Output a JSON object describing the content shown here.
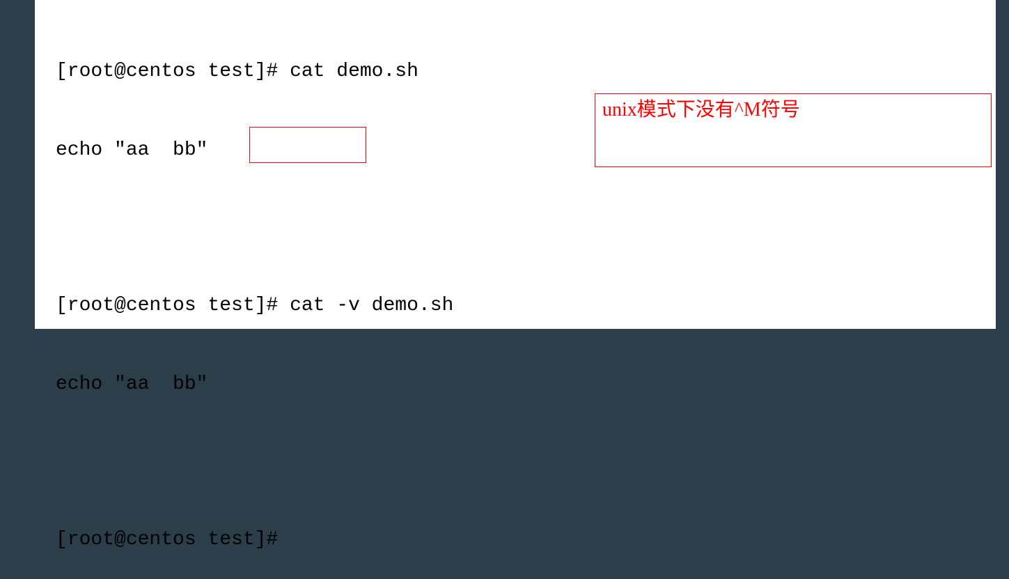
{
  "terminal": {
    "line1_prompt": "[root@centos test]# ",
    "line1_command": "cat demo.sh",
    "line2_output": "echo \"aa  bb\"",
    "line3_prompt": "[root@centos test]# ",
    "line3_command": "cat -v demo.sh",
    "line4_output": "echo \"aa  bb\"",
    "line5_prompt": "[root@centos test]# "
  },
  "annotation": {
    "text": "unix模式下没有^M符号"
  }
}
